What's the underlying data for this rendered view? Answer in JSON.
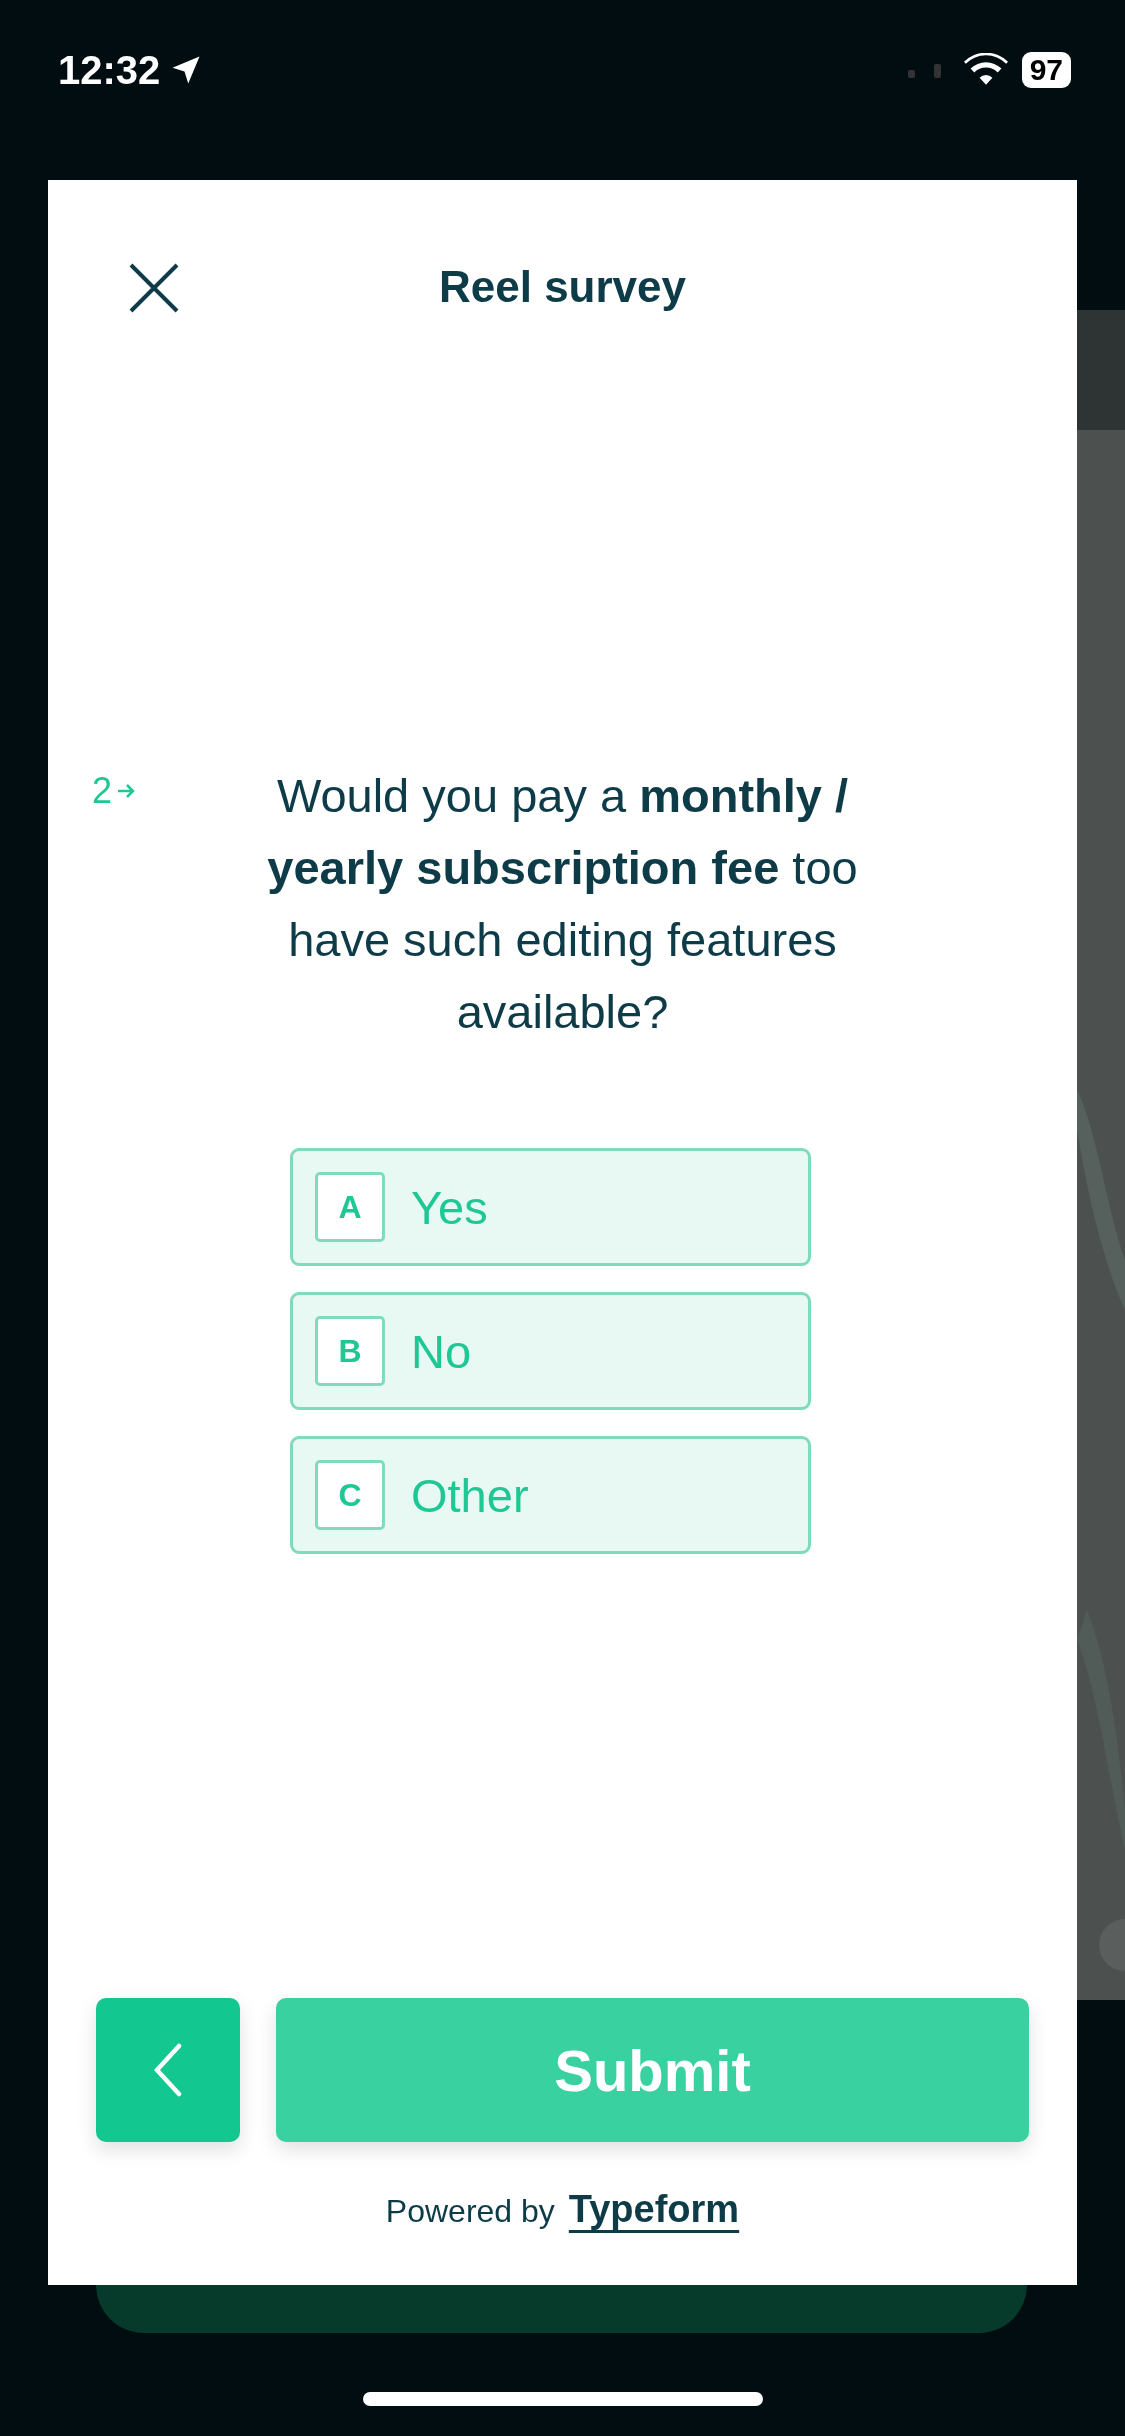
{
  "status_bar": {
    "time": "12:32",
    "battery": "97"
  },
  "survey": {
    "title": "Reel survey",
    "question_number": "2",
    "question": "Would you pay a **monthly / yearly subscription fee** too have such editing features available?",
    "options": [
      {
        "key": "A",
        "label": "Yes",
        "selected": false
      },
      {
        "key": "B",
        "label": "No",
        "selected": false
      },
      {
        "key": "C",
        "label": "Other",
        "selected": false
      }
    ],
    "submit": "Submit",
    "footer": {
      "prefix": "Powered by",
      "link": "Typeform"
    }
  }
}
